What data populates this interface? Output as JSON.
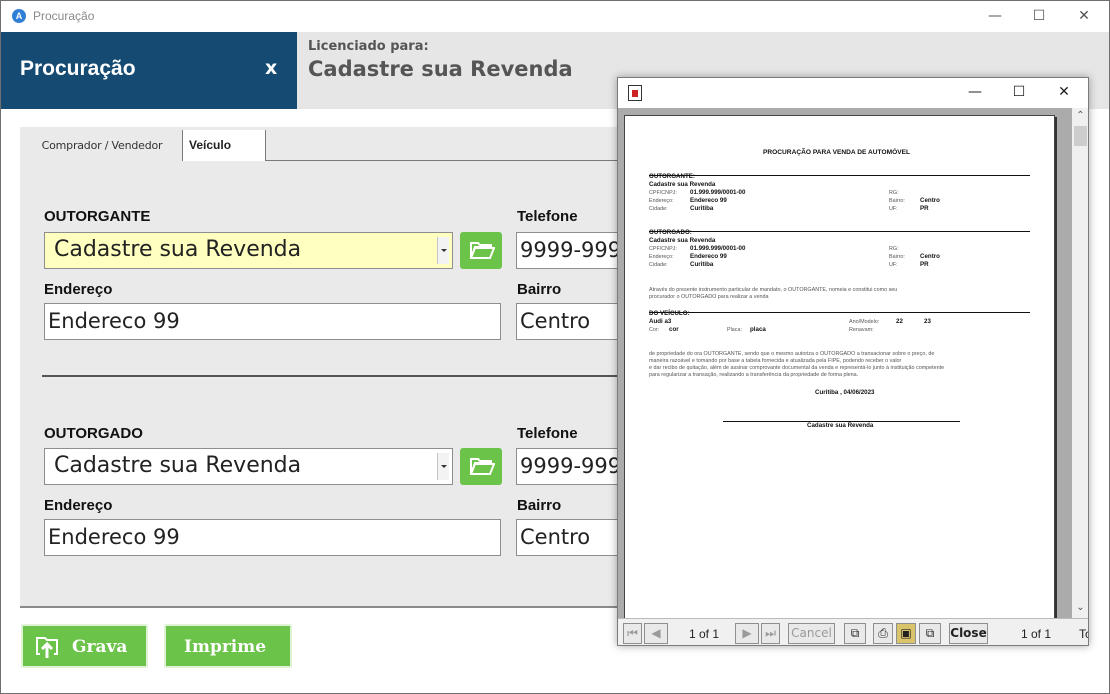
{
  "main_window": {
    "title": "Procuração",
    "controls": {
      "minimize": "—",
      "maximize": "☐",
      "close": "✕"
    }
  },
  "header": {
    "title": "Procuração",
    "close_glyph": "x",
    "license_label": "Licenciado para:",
    "license_name": "Cadastre sua Revenda"
  },
  "tabs": [
    {
      "label": "Comprador / Vendedor",
      "active": true
    },
    {
      "label": "Veículo",
      "active": false
    }
  ],
  "outorgante": {
    "label": "OUTORGANTE",
    "name_value": "Cadastre sua Revenda",
    "phone_label": "Telefone",
    "phone_value": "9999-999",
    "address_label": "Endereço",
    "address_value": "Endereco  99",
    "district_label": "Bairro",
    "district_value": "Centro"
  },
  "outorgado": {
    "label": "OUTORGADO",
    "name_value": "Cadastre sua Revenda",
    "phone_label": "Telefone",
    "phone_value": "9999-999",
    "address_label": "Endereço",
    "address_value": "Endereco  99",
    "district_label": "Bairro",
    "district_value": "Centro"
  },
  "actions": {
    "save_label": "Grava",
    "print_label": "Imprime"
  },
  "colors": {
    "header_blue": "#154a73",
    "green": "#6cc34a",
    "highlight_yellow": "#ffffc0"
  },
  "report_window": {
    "controls": {
      "minimize": "—",
      "maximize": "☐",
      "close": "✕"
    },
    "toolbar": {
      "page_indicator": "1 of 1",
      "cancel_label": "Cancel",
      "close_label": "Close",
      "page_count": "1 of 1",
      "trailing_text": "Tc"
    },
    "document": {
      "title": "PROCURAÇÃO PARA VENDA DE AUTOMÓVEL",
      "outorgante_heading": "OUTORGANTE:",
      "outorgante_name": "Cadastre sua Revenda",
      "outorgante_cpf_label": "CPF/CNPJ:",
      "outorgante_cpf": "01.999.999/0001-00",
      "outorgante_rg_label": "RG:",
      "outorgante_address_label": "Endereço:",
      "outorgante_address": "Endereco  99",
      "outorgante_district_label": "Bairro:",
      "outorgante_district": "Centro",
      "outorgante_city_label": "Cidade:",
      "outorgante_city": "Curitiba",
      "outorgante_uf_label": "UF:",
      "outorgante_uf": "PR",
      "outorgado_heading": "OUTORGADO:",
      "outorgado_name": "Cadastre sua Revenda",
      "outorgado_cpf_label": "CPF/CNPJ:",
      "outorgado_cpf": "01.999.999/0001-00",
      "outorgado_rg_label": "RG:",
      "outorgado_address_label": "Endereço:",
      "outorgado_address": "Endereco  99",
      "outorgado_district_label": "Bairro:",
      "outorgado_district": "Centro",
      "outorgado_city_label": "Cidade:",
      "outorgado_city": "Curitiba",
      "outorgado_uf_label": "UF:",
      "outorgado_uf": "PR",
      "mandate_line1": "Através do presente instrumento particular de mandato, o OUTORGANTE, nomeia e constitui como seu",
      "mandate_line2": "procurador o OUTORGADO para realizar a venda",
      "vehicle_heading": "DO VEÍCULO:",
      "vehicle_name": "Audi a3",
      "vehicle_year_label": "Ano/Modelo:",
      "vehicle_year": "22",
      "vehicle_model_year": "23",
      "vehicle_color_label": "Cor:",
      "vehicle_color": "cor",
      "vehicle_plate_label": "Placa:",
      "vehicle_plate": "placa",
      "vehicle_renavam_label": "Renavam:",
      "body_line1": "de propriedade do ora OUTORGANTE,  sendo que o mesmo autoriza o OUTORGADO a transacionar sobre o preço, de",
      "body_line2": "maneira razoável e tomando por base a tabela fornecida e atualizada pela  FIPE, podendo receber o valor",
      "body_line3": "e dar recibo de quitação, além de assinar comprovante documental da venda e representá-lo junto à instituição competente",
      "body_line4": "para regularizar a transação, realizando a transferência da propriedade de forma plena.",
      "place_date": "Curitiba , 04/06/2023",
      "signature_name": "Cadastre sua Revenda"
    }
  }
}
